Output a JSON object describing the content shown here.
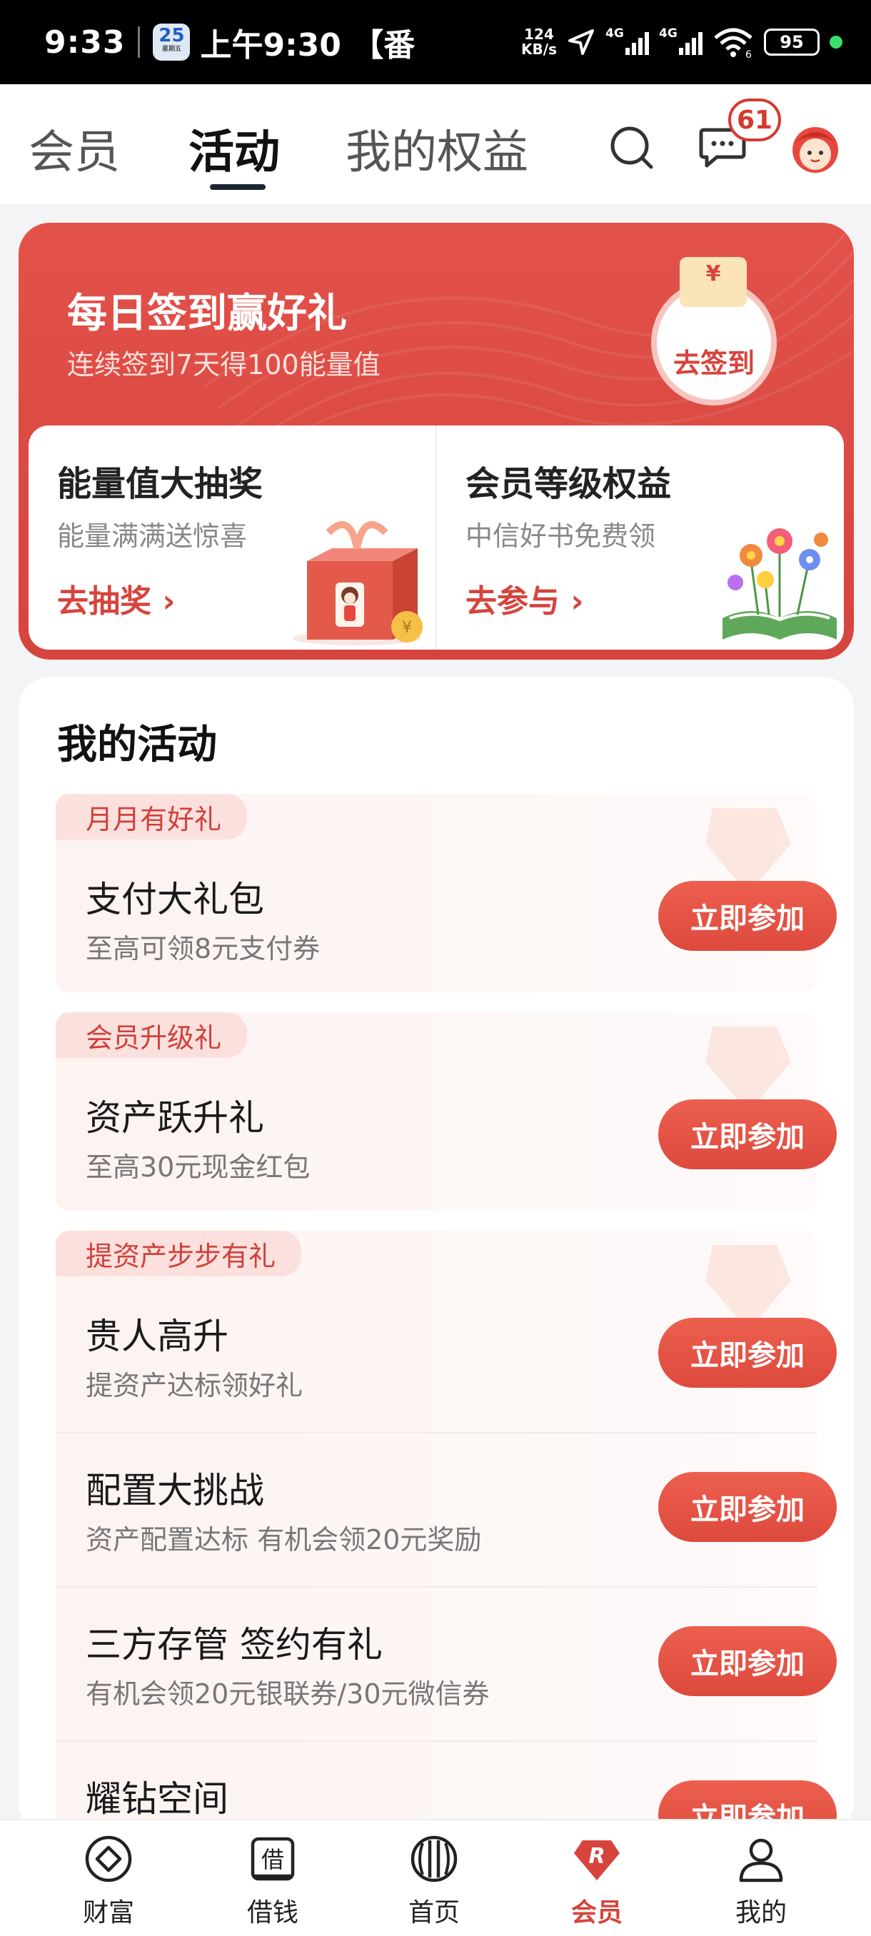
{
  "status_bar": {
    "time": "9:33",
    "calendar_day": "25",
    "calendar_sub": "星期五",
    "notification_text": "上午9:30 【番",
    "speed_value": "124",
    "speed_unit": "KB/s",
    "network_1": "4G",
    "network_2": "4G",
    "wifi_sub": "6",
    "battery": "95"
  },
  "top_nav": {
    "tabs": [
      {
        "label": "会员"
      },
      {
        "label": "活动",
        "active": true
      },
      {
        "label": "我的权益"
      }
    ],
    "message_badge": "61"
  },
  "signin_banner": {
    "title": "每日签到赢好礼",
    "subtitle": "连续签到7天得100能量值",
    "button_label": "去签到",
    "red_packet_symbol": "¥"
  },
  "feature_cards": [
    {
      "title": "能量值大抽奖",
      "subtitle": "能量满满送惊喜",
      "link": "去抽奖"
    },
    {
      "title": "会员等级权益",
      "subtitle": "中信好书免费领",
      "link": "去参与"
    }
  ],
  "my_activities": {
    "heading": "我的活动",
    "items": [
      {
        "tag": "月月有好礼",
        "title": "支付大礼包",
        "desc": "至高可领8元支付券",
        "button": "立即参加"
      },
      {
        "tag": "会员升级礼",
        "title": "资产跃升礼",
        "desc": "至高30元现金红包",
        "button": "立即参加"
      },
      {
        "tag": "提资产步步有礼",
        "title": "贵人高升",
        "desc": "提资产达标领好礼",
        "button": "立即参加"
      },
      {
        "title": "配置大挑战",
        "desc": "资产配置达标 有机会领20元奖励",
        "button": "立即参加"
      },
      {
        "title": "三方存管 签约有礼",
        "desc": "有机会领20元银联券/30元微信券",
        "button": "立即参加"
      },
      {
        "title": "耀钻空间",
        "button": "立即参加"
      }
    ]
  },
  "bottom_nav": {
    "items": [
      {
        "label": "财富",
        "icon": "wealth-icon"
      },
      {
        "label": "借钱",
        "icon": "borrow-icon",
        "icon_char": "借"
      },
      {
        "label": "首页",
        "icon": "home-icon"
      },
      {
        "label": "会员",
        "icon": "member-icon",
        "icon_char": "R",
        "active": true
      },
      {
        "label": "我的",
        "icon": "profile-icon"
      }
    ]
  },
  "colors": {
    "brand_red": "#d6443d",
    "button_red": "#e5523f",
    "tag_bg": "#fbe0dd"
  }
}
